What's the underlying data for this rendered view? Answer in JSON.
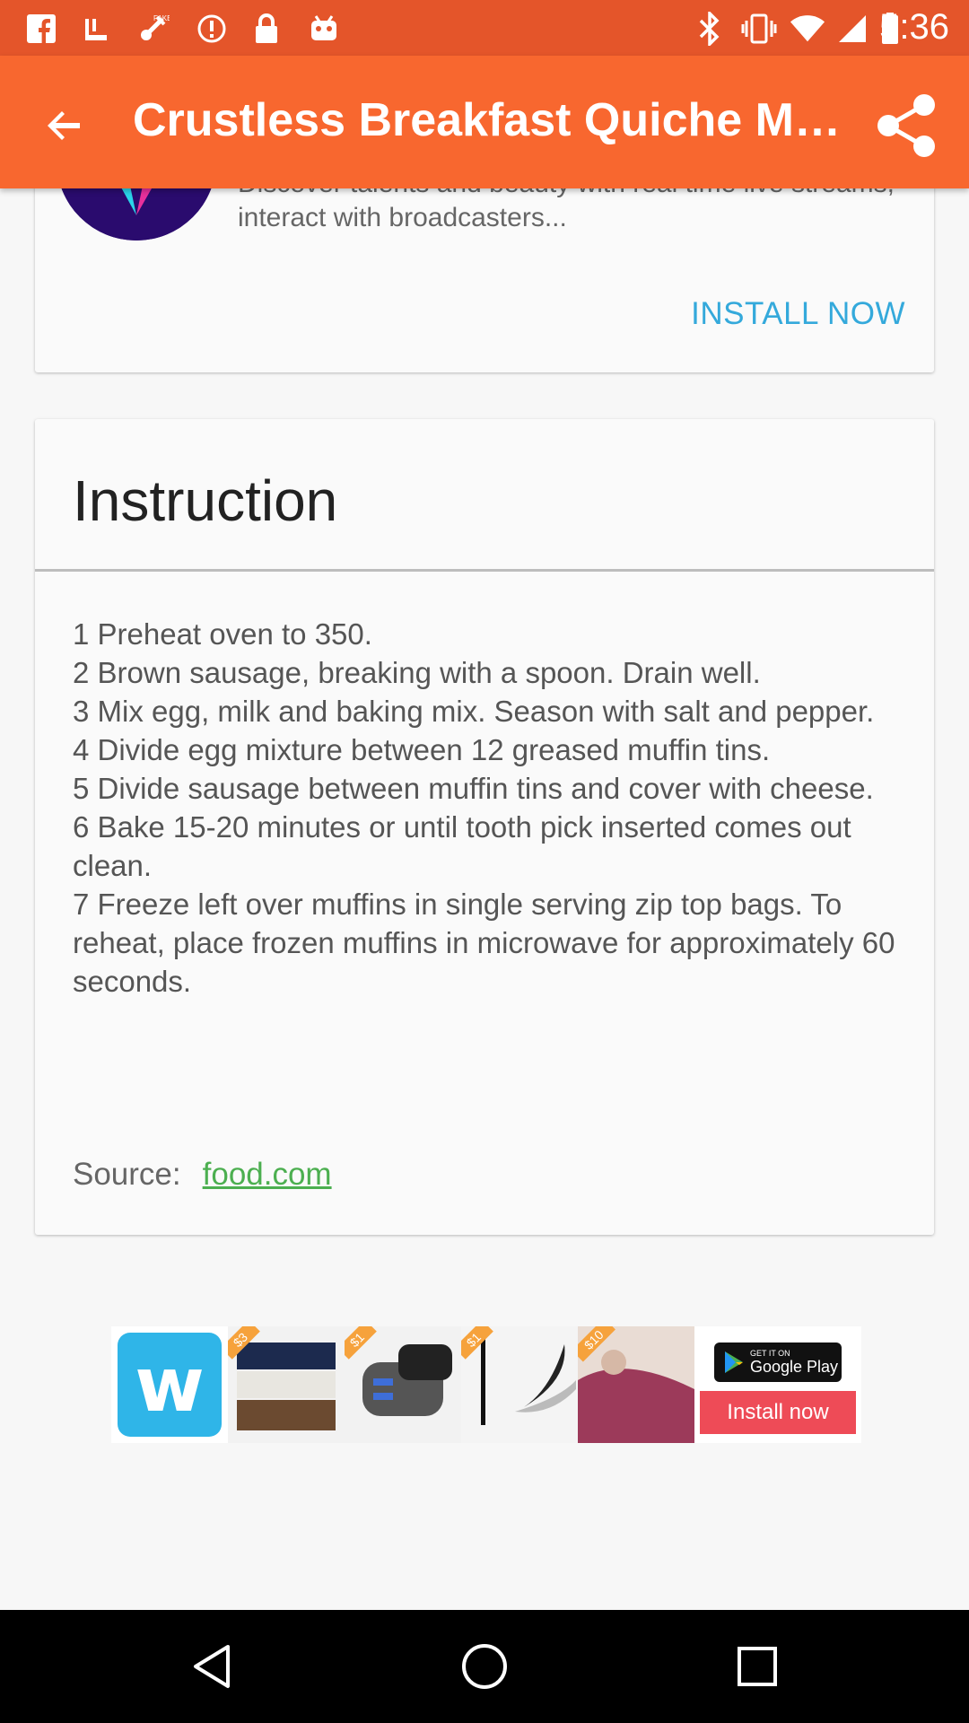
{
  "status_bar": {
    "time": "5:36",
    "left_icons": [
      "facebook-icon",
      "hanger-icon",
      "fake-gps-icon",
      "info-icon",
      "lock-icon",
      "android-icon"
    ],
    "right_icons": [
      "bluetooth-icon",
      "vibrate-icon",
      "wifi-icon",
      "signal-icon",
      "battery-icon"
    ]
  },
  "app_bar": {
    "title": "Crustless Breakfast Quiche Muf…",
    "back_icon": "arrow-back-icon",
    "share_icon": "share-icon"
  },
  "ad_card": {
    "description": "Discover talents and beauty with real time live streams, interact with broadcasters...",
    "install_label": "INSTALL NOW"
  },
  "instruction_card": {
    "title": "Instruction",
    "steps": [
      "1 Preheat oven to 350.",
      "2 Brown sausage, breaking with a spoon. Drain well.",
      "3 Mix egg, milk and baking mix. Season with salt and pepper.",
      "4 Divide egg mixture between 12 greased muffin tins.",
      "5 Divide sausage between muffin tins and cover with cheese.",
      "6 Bake 15-20 minutes or until tooth pick inserted comes out clean.",
      "7 Freeze left over muffins in single serving zip top bags. To reheat, place frozen muffins in microwave for approximately 60 seconds."
    ],
    "source_label": "Source:",
    "source_link": "food.com"
  },
  "banner_ad": {
    "brand": "w",
    "tiles": [
      {
        "price": "$3",
        "item": "towels"
      },
      {
        "price": "$1",
        "item": "car charger"
      },
      {
        "price": "$1",
        "item": "makeup brush"
      },
      {
        "price": "$10",
        "item": "blanket"
      }
    ],
    "store_small": "GET IT ON",
    "store_big": "Google Play",
    "install_label": "Install now"
  },
  "nav_bar": {
    "back": "nav-back-icon",
    "home": "nav-home-icon",
    "recents": "nav-recents-icon"
  },
  "colors": {
    "status_bar": "#e4552a",
    "app_bar": "#f8672f",
    "install_now": "#34a9db",
    "source_link": "#4caf50",
    "wish_blue": "#2fb5e8",
    "install_red": "#ee4b57"
  }
}
